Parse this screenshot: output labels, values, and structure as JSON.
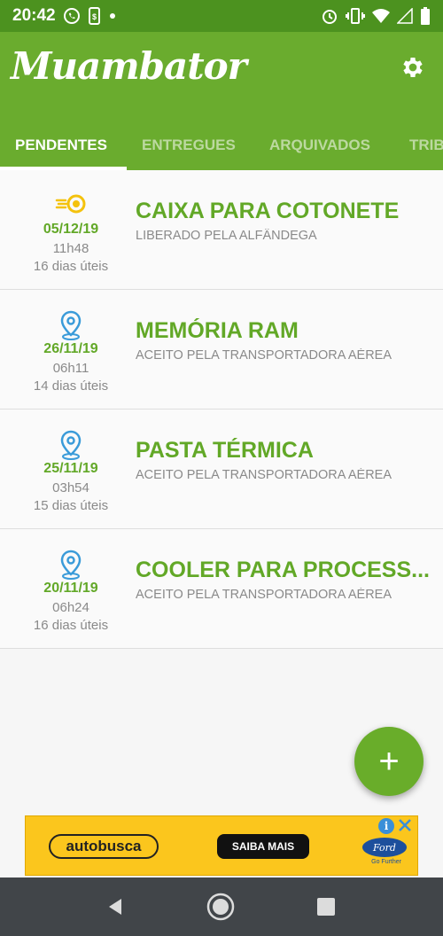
{
  "status_bar": {
    "time": "20:42"
  },
  "app": {
    "title": "Muambator"
  },
  "tabs": [
    {
      "label": "PENDENTES",
      "active": true
    },
    {
      "label": "ENTREGUES",
      "active": false
    },
    {
      "label": "ARQUIVADOS",
      "active": false
    },
    {
      "label": "TRIB",
      "active": false
    }
  ],
  "packages": [
    {
      "icon": "customs-sun-icon",
      "date": "05/12/19",
      "time": "11h48",
      "days": "16 dias úteis",
      "title": "CAIXA PARA COTONETE",
      "status": "LIBERADO PELA ALFÂNDEGA"
    },
    {
      "icon": "location-pin-icon",
      "date": "26/11/19",
      "time": "06h11",
      "days": "14 dias úteis",
      "title": "MEMÓRIA RAM",
      "status": "ACEITO PELA TRANSPORTADORA AÉREA"
    },
    {
      "icon": "location-pin-icon",
      "date": "25/11/19",
      "time": "03h54",
      "days": "15 dias úteis",
      "title": "PASTA TÉRMICA",
      "status": "ACEITO PELA TRANSPORTADORA AÉREA"
    },
    {
      "icon": "location-pin-icon",
      "date": "20/11/19",
      "time": "06h24",
      "days": "16 dias úteis",
      "title": "COOLER PARA PROCESS...",
      "status": "ACEITO PELA TRANSPORTADORA AÉREA"
    }
  ],
  "fab": {
    "label": "+"
  },
  "ad": {
    "logo": "autobusca",
    "cta": "SAIBA MAIS",
    "brand": "Ford",
    "brand_sub": "Go Further"
  },
  "colors": {
    "primary": "#6aac2e",
    "status_bar": "#4c921f",
    "accent_text": "#62a827",
    "ad_bg": "#fbc61d"
  }
}
